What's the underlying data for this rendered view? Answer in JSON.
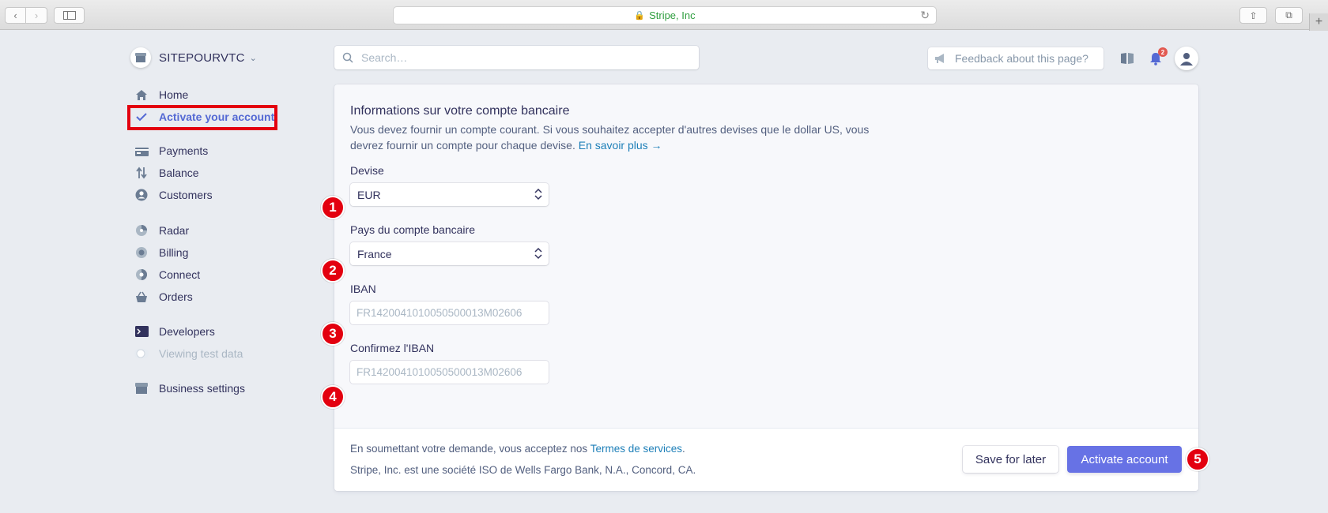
{
  "browser": {
    "url_text": "Stripe, Inc"
  },
  "account": {
    "name": "SITEPOURVTC"
  },
  "sidebar": {
    "items": [
      {
        "label": "Home",
        "icon": "home-icon"
      },
      {
        "label": "Activate your account",
        "icon": "check-icon"
      },
      {
        "label": "Payments",
        "icon": "payments-icon"
      },
      {
        "label": "Balance",
        "icon": "balance-icon"
      },
      {
        "label": "Customers",
        "icon": "customers-icon"
      },
      {
        "label": "Radar",
        "icon": "radar-icon"
      },
      {
        "label": "Billing",
        "icon": "billing-icon"
      },
      {
        "label": "Connect",
        "icon": "connect-icon"
      },
      {
        "label": "Orders",
        "icon": "orders-icon"
      },
      {
        "label": "Developers",
        "icon": "developers-icon"
      },
      {
        "label": "Viewing test data",
        "icon": "toggle-icon"
      },
      {
        "label": "Business settings",
        "icon": "business-settings-icon"
      }
    ]
  },
  "topbar": {
    "search_placeholder": "Search…",
    "feedback_label": "Feedback about this page?",
    "notification_count": "2"
  },
  "form": {
    "title": "Informations sur votre compte bancaire",
    "description": "Vous devez fournir un compte courant. Si vous souhaitez accepter d'autres devises que le dollar US, vous devrez fournir un compte pour chaque devise.",
    "learn_more": "En savoir plus →",
    "currency_label": "Devise",
    "currency_value": "EUR",
    "country_label": "Pays du compte bancaire",
    "country_value": "France",
    "iban_label": "IBAN",
    "iban_placeholder": "FR1420041010050500013M02606",
    "confirm_iban_label": "Confirmez l'IBAN",
    "confirm_iban_placeholder": "FR1420041010050500013M02606"
  },
  "footer": {
    "terms_prefix": "En soumettant votre demande, vous acceptez nos",
    "terms_link": "Termes de services",
    "terms_suffix": ".",
    "iso_text": "Stripe, Inc. est une société ISO de Wells Fargo Bank, N.A., Concord, CA.",
    "save_label": "Save for later",
    "activate_label": "Activate account"
  },
  "annotations": [
    "1",
    "2",
    "3",
    "4",
    "5"
  ],
  "colors": {
    "accent": "#6772e5",
    "active_nav": "#5469d4",
    "highlight": "#e3000f",
    "link": "#1d7fb8"
  }
}
